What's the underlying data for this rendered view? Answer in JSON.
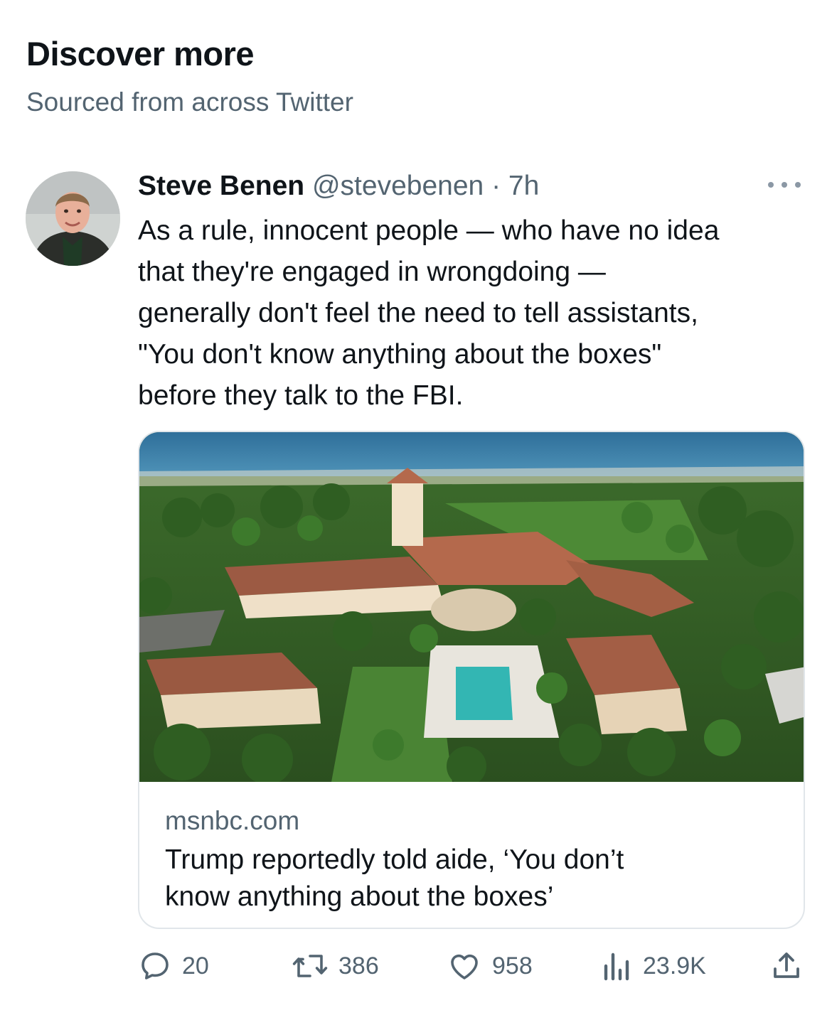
{
  "section": {
    "title": "Discover more",
    "subtitle": "Sourced from across Twitter"
  },
  "tweet": {
    "author_name": "Steve Benen",
    "handle": "@stevebenen",
    "separator": "·",
    "time": "7h",
    "text_lines": [
      "As a rule, innocent people — who have no idea",
      "that they're engaged in wrongdoing —",
      "generally don't feel the need to tell assistants,",
      "\"You don't know anything about the boxes\"",
      "before they talk to the FBI."
    ],
    "card": {
      "domain": "msnbc.com",
      "headline_lines": [
        "Trump reportedly told aide, ‘You don’t",
        "know anything about the boxes’"
      ]
    },
    "actions": {
      "replies": "20",
      "retweets": "386",
      "likes": "958",
      "views": "23.9K"
    }
  },
  "icons": {
    "more": "more-horizontal-icon",
    "reply": "reply-icon",
    "retweet": "retweet-icon",
    "like": "heart-icon",
    "views": "analytics-icon",
    "share": "share-icon"
  },
  "colors": {
    "text_primary": "#0f1419",
    "text_secondary": "#536471",
    "card_border": "#e1e6ea"
  }
}
